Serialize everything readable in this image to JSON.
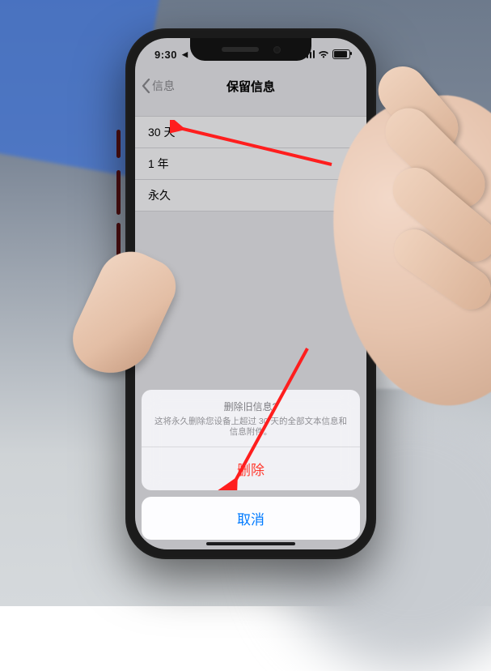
{
  "status": {
    "time": "9:30",
    "time_marker": "◀"
  },
  "nav": {
    "back_label": "信息",
    "title": "保留信息"
  },
  "options": [
    {
      "label": "30 天",
      "selected": false
    },
    {
      "label": "1 年",
      "selected": false
    },
    {
      "label": "永久",
      "selected": true
    }
  ],
  "sheet": {
    "title": "删除旧信息?",
    "message": "这将永久删除您设备上超过 30 天的全部文本信息和信息附件。",
    "destructive_label": "删除",
    "cancel_label": "取消"
  }
}
